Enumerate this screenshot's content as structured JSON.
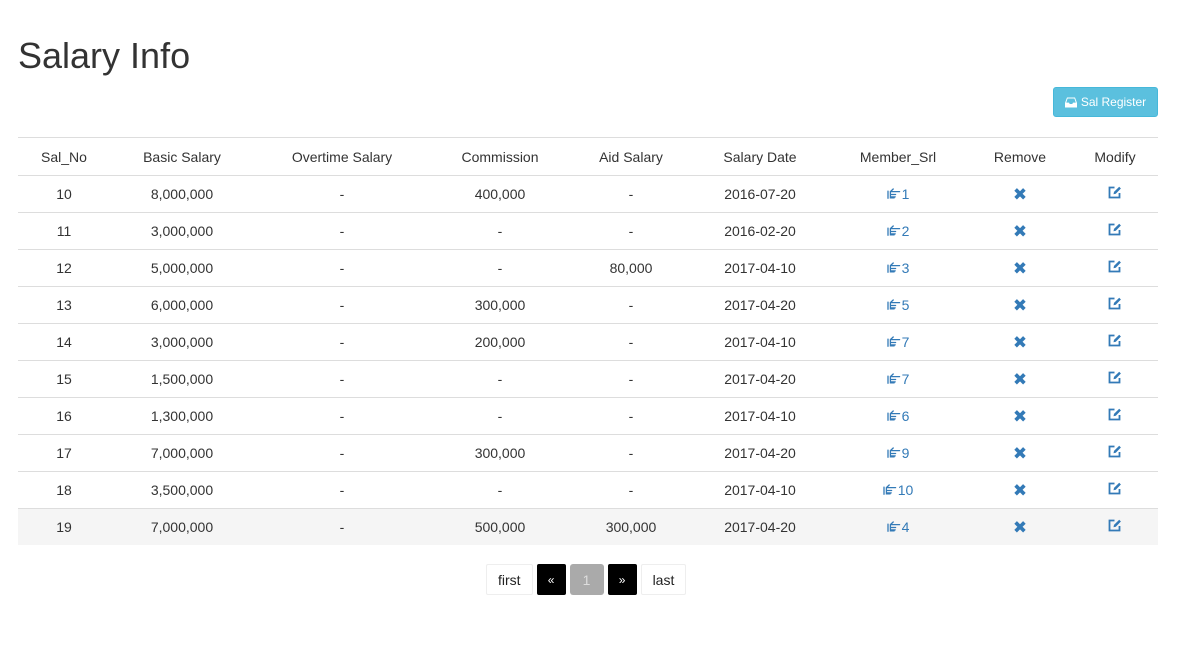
{
  "page": {
    "title": "Salary Info"
  },
  "toolbar": {
    "register_label": "Sal Register",
    "register_icon": "inbox-icon"
  },
  "table": {
    "headers": [
      "Sal_No",
      "Basic Salary",
      "Overtime Salary",
      "Commission",
      "Aid Salary",
      "Salary Date",
      "Member_Srl",
      "Remove",
      "Modify"
    ],
    "rows": [
      {
        "sal_no": "10",
        "basic": "8,000,000",
        "overtime": "-",
        "commission": "400,000",
        "aid": "-",
        "date": "2016-07-20",
        "member": "1"
      },
      {
        "sal_no": "11",
        "basic": "3,000,000",
        "overtime": "-",
        "commission": "-",
        "aid": "-",
        "date": "2016-02-20",
        "member": "2"
      },
      {
        "sal_no": "12",
        "basic": "5,000,000",
        "overtime": "-",
        "commission": "-",
        "aid": "80,000",
        "date": "2017-04-10",
        "member": "3"
      },
      {
        "sal_no": "13",
        "basic": "6,000,000",
        "overtime": "-",
        "commission": "300,000",
        "aid": "-",
        "date": "2017-04-20",
        "member": "5"
      },
      {
        "sal_no": "14",
        "basic": "3,000,000",
        "overtime": "-",
        "commission": "200,000",
        "aid": "-",
        "date": "2017-04-10",
        "member": "7"
      },
      {
        "sal_no": "15",
        "basic": "1,500,000",
        "overtime": "-",
        "commission": "-",
        "aid": "-",
        "date": "2017-04-20",
        "member": "7"
      },
      {
        "sal_no": "16",
        "basic": "1,300,000",
        "overtime": "-",
        "commission": "-",
        "aid": "-",
        "date": "2017-04-10",
        "member": "6"
      },
      {
        "sal_no": "17",
        "basic": "7,000,000",
        "overtime": "-",
        "commission": "300,000",
        "aid": "-",
        "date": "2017-04-20",
        "member": "9"
      },
      {
        "sal_no": "18",
        "basic": "3,500,000",
        "overtime": "-",
        "commission": "-",
        "aid": "-",
        "date": "2017-04-10",
        "member": "10"
      },
      {
        "sal_no": "19",
        "basic": "7,000,000",
        "overtime": "-",
        "commission": "500,000",
        "aid": "300,000",
        "date": "2017-04-20",
        "member": "4"
      }
    ],
    "highlighted_row": 9,
    "remove_icon": "remove-x-icon",
    "modify_icon": "edit-icon",
    "member_icon": "hand-pointing-icon",
    "accent_color": "#337ab7"
  },
  "pagination": {
    "first_label": "first",
    "prev_label": "«",
    "current_page": "1",
    "next_label": "»",
    "last_label": "last"
  }
}
